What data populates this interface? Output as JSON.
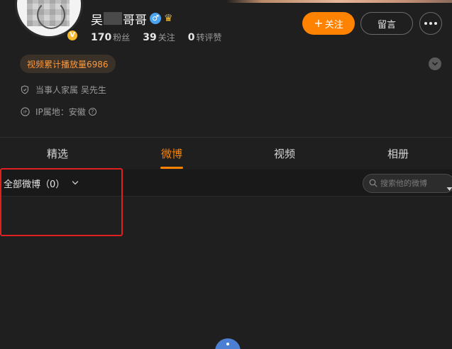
{
  "profile": {
    "name_prefix": "吴",
    "name_suffix": "哥哥",
    "verified_mark": "V",
    "gender_icon": "male-icon",
    "member_icon": "crown-icon",
    "stats": [
      {
        "value": "170",
        "label": "粉丝"
      },
      {
        "value": "39",
        "label": "关注"
      },
      {
        "value": "0",
        "label": "转评赞"
      }
    ],
    "play_count_tag": "视频累计播放量6986",
    "family_info": "当事人家属 吴先生",
    "ip_info": "IP属地：安徽"
  },
  "actions": {
    "follow_label": "关注",
    "follow_plus": "+",
    "message_label": "留言"
  },
  "tabs": [
    {
      "label": "精选",
      "active": false
    },
    {
      "label": "微博",
      "active": true
    },
    {
      "label": "视频",
      "active": false
    },
    {
      "label": "相册",
      "active": false
    }
  ],
  "filter": {
    "selected": "全部微博（0）",
    "search_placeholder": "搜索他的微博"
  },
  "colors": {
    "accent": "#ff8200",
    "background": "#1f1f1f",
    "highlight": "#e02020",
    "verified": "#f5b92b",
    "fab": "#4a7fd4"
  }
}
